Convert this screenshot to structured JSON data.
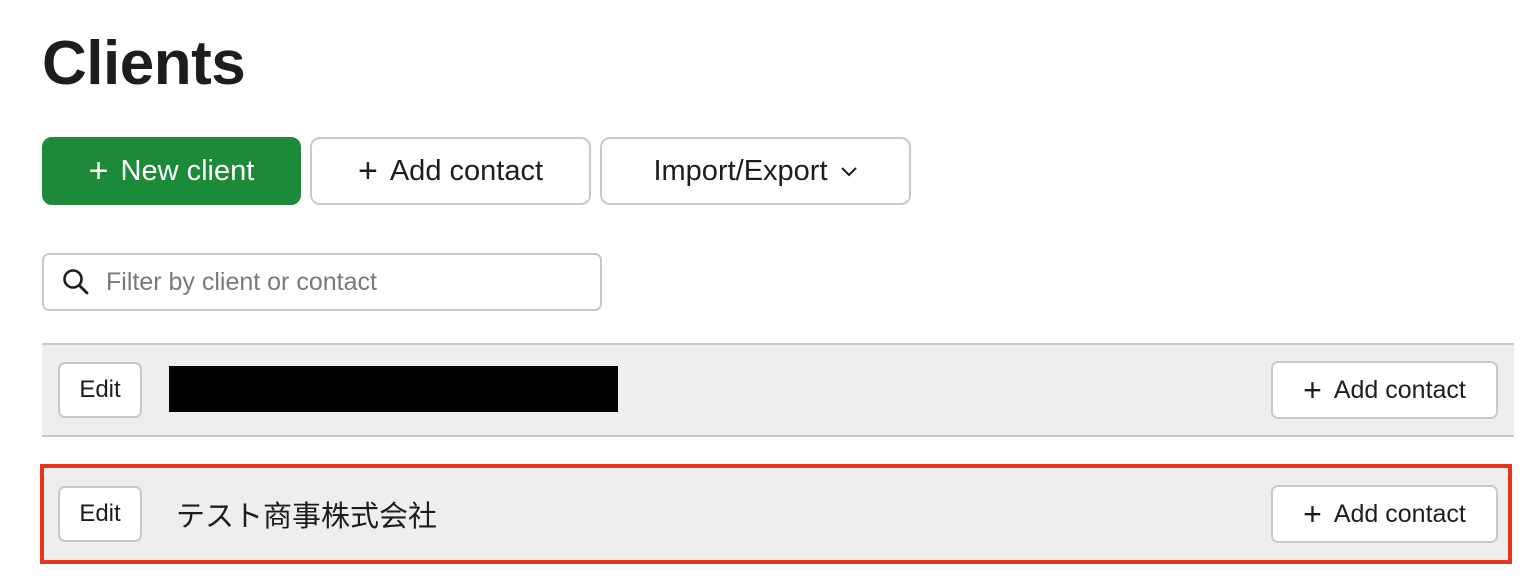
{
  "page": {
    "title": "Clients"
  },
  "toolbar": {
    "new_client_label": "New client",
    "add_contact_label": "Add contact",
    "import_export_label": "Import/Export"
  },
  "search": {
    "placeholder": "Filter by client or contact",
    "value": ""
  },
  "clients": [
    {
      "edit_label": "Edit",
      "name": "",
      "name_redacted": true,
      "add_contact_label": "Add contact"
    },
    {
      "edit_label": "Edit",
      "name": "テスト商事株式会社",
      "name_redacted": false,
      "add_contact_label": "Add contact",
      "highlighted": true
    }
  ],
  "colors": {
    "primary": "#1d8a3a",
    "highlight": "#e8331f",
    "row_bg": "#eeeeee",
    "border": "#c9c9c9"
  },
  "icons": {
    "plus": "plus-icon",
    "search": "search-icon",
    "dropdown": "chevron-down-icon"
  }
}
